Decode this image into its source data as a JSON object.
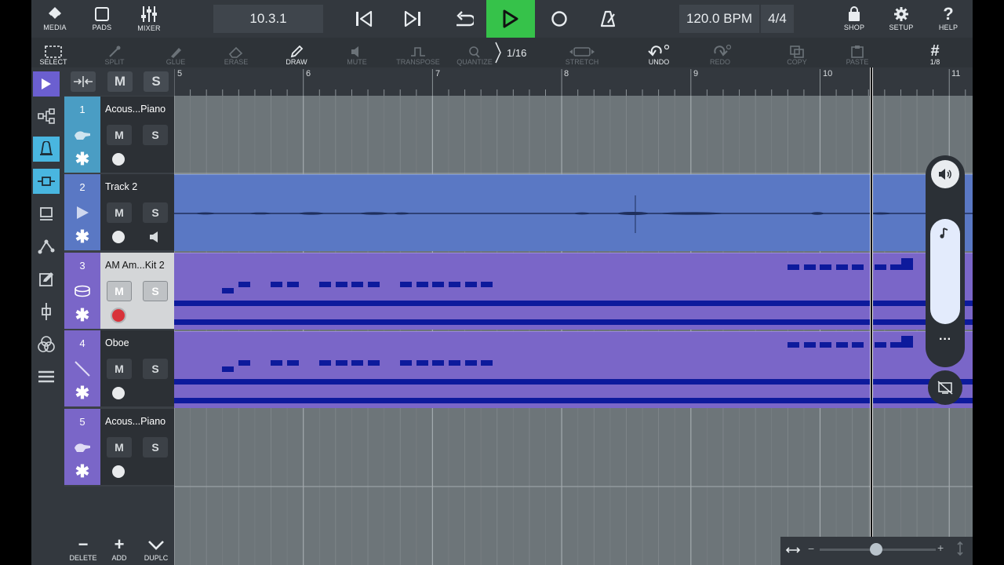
{
  "toolbar": {
    "media": "MEDIA",
    "pads": "PADS",
    "mixer": "MIXER",
    "position": "10.3.1",
    "tempo": "120.0 BPM",
    "signature": "4/4",
    "shop": "SHOP",
    "setup": "SETUP",
    "help": "HELP"
  },
  "editbar": {
    "select": "SELECT",
    "split": "SPLIT",
    "glue": "GLUE",
    "erase": "ERASE",
    "draw": "DRAW",
    "mute": "MUTE",
    "transpose": "TRANSPOSE",
    "quantize": "QUANTIZE",
    "quantize_value": "1/16",
    "stretch": "STRETCH",
    "undo": "UNDO",
    "redo": "REDO",
    "copy": "COPY",
    "paste": "PASTE",
    "grid_value": "1/8"
  },
  "header": {
    "mute_label": "M",
    "solo_label": "S"
  },
  "tracks": [
    {
      "num": "1",
      "name": "Acous...Piano",
      "mute": "M",
      "solo": "S"
    },
    {
      "num": "2",
      "name": "Track 2",
      "mute": "M",
      "solo": "S"
    },
    {
      "num": "3",
      "name": "AM Am...Kit 2",
      "mute": "M",
      "solo": "S"
    },
    {
      "num": "4",
      "name": "Oboe",
      "mute": "M",
      "solo": "S"
    },
    {
      "num": "5",
      "name": "Acous...Piano",
      "mute": "M",
      "solo": "S"
    }
  ],
  "ruler": [
    "5",
    "6",
    "7",
    "8",
    "9",
    "10",
    "11"
  ],
  "bottom": {
    "delete": "DELETE",
    "add": "ADD",
    "duplicate": "DUPLC"
  },
  "colors": {
    "accent_blue": "#49b6e0",
    "play_green": "#36c24a",
    "track_blue": "#5a78c4",
    "track_purple": "#7a66c8",
    "note_navy": "#0d1a9c",
    "record_red": "#d8323a"
  }
}
